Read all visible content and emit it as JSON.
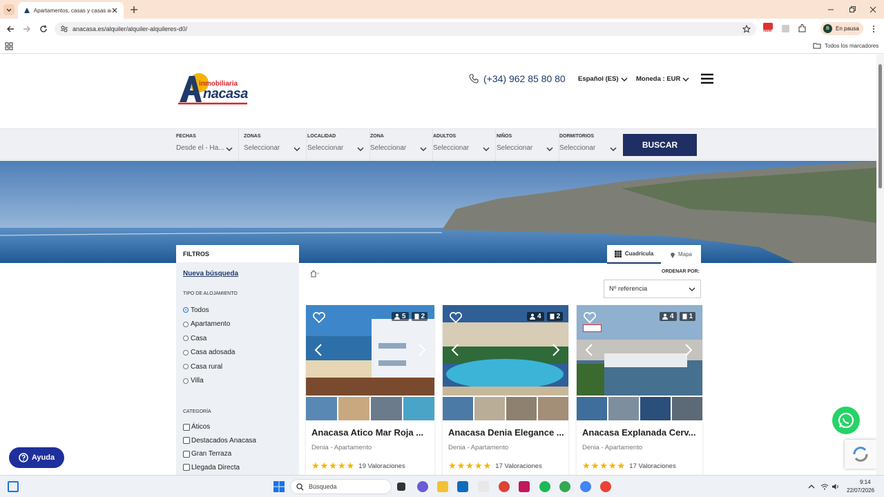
{
  "browser": {
    "tab_title": "Apartamentos, casas y casas ad",
    "url": "anacasa.es/alquiler/alquiler-alquileres-d0/",
    "profile_initial": "B",
    "profile_status": "En pausa",
    "bookmarks_folder": "Todos los marcadores",
    "new_badge": "New"
  },
  "site": {
    "logo_top": "inmobiliaria",
    "logo_main": "nacasa",
    "logo_letter": "A",
    "phone": "(+34) 962 85 80 80",
    "language": "Español (ES)",
    "currency": "Moneda : EUR"
  },
  "search": {
    "fields": [
      {
        "label": "FECHAS",
        "value": "Desde el - Ha..."
      },
      {
        "label": "ZONAS",
        "value": "Seleccionar"
      },
      {
        "label": "LOCALIDAD",
        "value": "Seleccionar"
      },
      {
        "label": "ZONA",
        "value": "Seleccionar"
      },
      {
        "label": "ADULTOS",
        "value": "Seleccionar"
      },
      {
        "label": "NIÑOS",
        "value": "Seleccionar"
      },
      {
        "label": "DORMITORIOS",
        "value": "Seleccionar"
      }
    ],
    "button": "BUSCAR"
  },
  "filters": {
    "title": "FILTROS",
    "new_search": "Nueva búsqueda",
    "type_title": "TIPO DE ALOJAMIENTO",
    "types": [
      "Todos",
      "Apartamento",
      "Casa",
      "Casa adosada",
      "Casa rural",
      "Villa"
    ],
    "category_title": "CATEGORÍA",
    "categories": [
      "Áticos",
      "Destacados Anacasa",
      "Gran Terraza",
      "Llegada Directa"
    ]
  },
  "view": {
    "grid": "Cuadrícula",
    "map": "Mapa",
    "order_label": "ORDENAR POR:",
    "order_value": "Nº referencia"
  },
  "cards": [
    {
      "title": "Anacasa Atico Mar Roja ...",
      "subtitle": "Denia - Apartamento",
      "guests": "5",
      "rooms": "2",
      "reviews": "19 Valoraciones",
      "stars": "★★★★★"
    },
    {
      "title": "Anacasa Denia Elegance ...",
      "subtitle": "Denia - Apartamento",
      "guests": "4",
      "rooms": "2",
      "reviews": "17 Valoraciones",
      "stars": "★★★★★"
    },
    {
      "title": "Anacasa Explanada Cerv...",
      "subtitle": "Denia - Apartamento",
      "guests": "4",
      "rooms": "1",
      "reviews": "17 Valoraciones",
      "stars": "★★★★★"
    }
  ],
  "help_button": "Ayuda",
  "taskbar": {
    "search_placeholder": "Búsqueda",
    "time": "9:14",
    "date": "22/07/2026"
  },
  "colors": {
    "brand_navy": "#1f3a6b",
    "brand_red": "#d3262f",
    "brand_yellow": "#f5b400",
    "whatsapp": "#25d366"
  }
}
